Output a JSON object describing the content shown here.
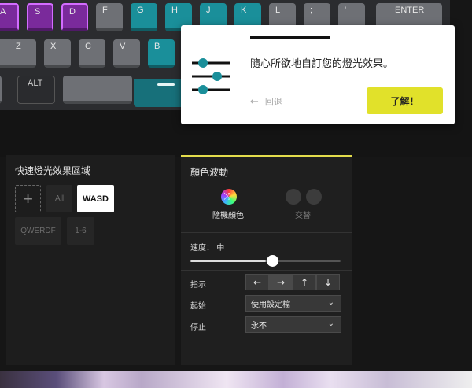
{
  "keyboard": {
    "row1": [
      "A",
      "S",
      "D",
      "F",
      "G",
      "H",
      "J",
      "K",
      "L",
      ";",
      "'",
      "ENTER"
    ],
    "row1_sub": [
      "",
      "",
      "",
      "",
      "",
      "",
      "",
      "",
      "",
      ":",
      "\"",
      ""
    ],
    "row2": [
      "Z",
      "X",
      "C",
      "V",
      "B"
    ],
    "alt": "ALT"
  },
  "popup": {
    "message": "隨心所欲地自訂您的燈光效果。",
    "back_label": "回退",
    "ok_label": "了解！"
  },
  "quick_zone": {
    "title": "快速燈光效果區域",
    "items": [
      "All",
      "WASD",
      "QWERDF",
      "1-6"
    ]
  },
  "color_wave": {
    "title": "顏色波動",
    "random_label": "隨機顏色",
    "alternate_label": "交替",
    "speed_label": "速度：",
    "speed_value": "中",
    "speed_level": 0.5,
    "direction_label": "指示",
    "directions": [
      "←",
      "→",
      "↑",
      "↓"
    ],
    "start_label": "起始",
    "start_value": "使用設定檔",
    "stop_label": "停止",
    "stop_value": "永不"
  },
  "colors": {
    "accent_yellow": "#e1e12a",
    "teal": "#1a8f9a",
    "purple": "#7a2a9b"
  }
}
